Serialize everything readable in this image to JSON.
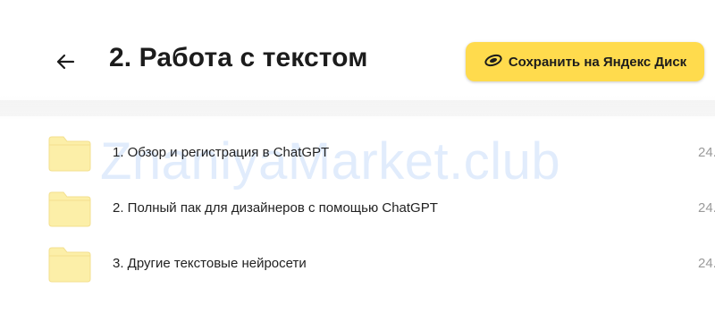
{
  "header": {
    "title": "2. Работа с текстом",
    "back_icon": "arrow-left-icon",
    "save_button": {
      "label": "Сохранить на Яндекс Диск",
      "icon": "yandex-disk-icon",
      "color": "#ffdb4d"
    }
  },
  "files": [
    {
      "name": "1. Обзор и регистрация в ChatGPT",
      "date": "24.",
      "icon": "folder-icon"
    },
    {
      "name": "2. Полный пак для дизайнеров с помощью ChatGPT",
      "date": "24.",
      "icon": "folder-icon"
    },
    {
      "name": "3. Другие текстовые нейросети",
      "date": "24.",
      "icon": "folder-icon"
    }
  ],
  "watermark": "ZnaniyaMarket.club",
  "colors": {
    "folder": "#fcefa8",
    "folder_tab": "#f7e392",
    "accent": "#ffdb4d"
  }
}
